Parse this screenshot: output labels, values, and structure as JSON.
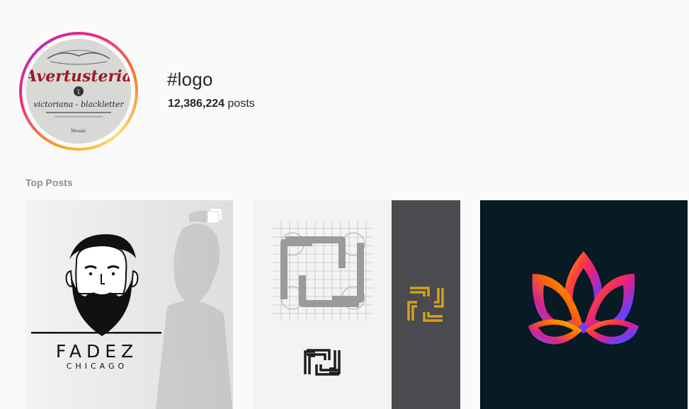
{
  "header": {
    "hashtag": "#logo",
    "post_count": "12,386,224",
    "posts_word": "posts"
  },
  "avatar": {
    "icon": "blackletter-logo-avatar",
    "lettering": [
      "Avertusteria",
      "victoriana - blackletter"
    ]
  },
  "section": {
    "top_posts_label": "Top Posts"
  },
  "posts": [
    {
      "icon": "bearded-man-logo",
      "brand": "FADEZ",
      "location": "CHICAGO",
      "multi_image": true
    },
    {
      "icon": "interlocking-square-knot-logo",
      "multi_image": false
    },
    {
      "icon": "lotus-gradient-logo",
      "multi_image": false
    }
  ],
  "colors": {
    "ring_start": "#f9a11b",
    "ring_end": "#c724b1",
    "muted_text": "#8e8e8e",
    "dark_post_bg": "#081a24"
  }
}
